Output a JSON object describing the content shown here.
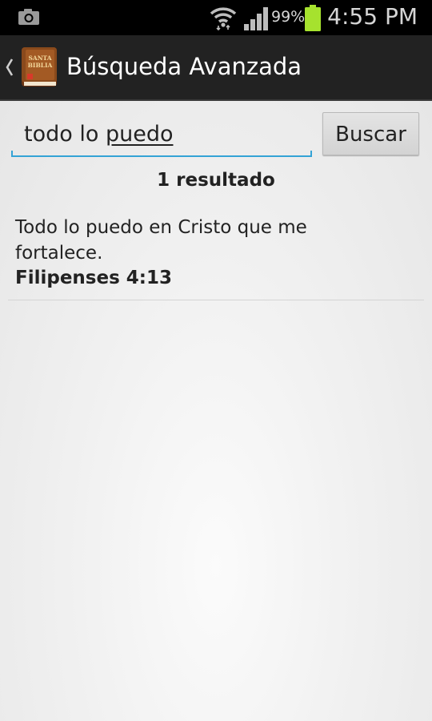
{
  "status_bar": {
    "battery_percent": "99%",
    "time": "4:55 PM",
    "icons": [
      "camera-icon",
      "wifi-icon",
      "signal-icon",
      "battery-icon"
    ],
    "battery_color": "#a6e22e"
  },
  "action_bar": {
    "title": "Búsqueda Avanzada",
    "app_icon_text": [
      "SANTA",
      "BIBLIA"
    ],
    "background": "#222222"
  },
  "search": {
    "value_plain": "todo lo ",
    "value_underlined": "puedo",
    "button_label": "Buscar",
    "accent_color": "#34a3d6"
  },
  "results": {
    "count_label": "1 resultado",
    "items": [
      {
        "text": "Todo lo puedo en Cristo que me fortalece.",
        "reference": "Filipenses 4:13"
      }
    ]
  }
}
